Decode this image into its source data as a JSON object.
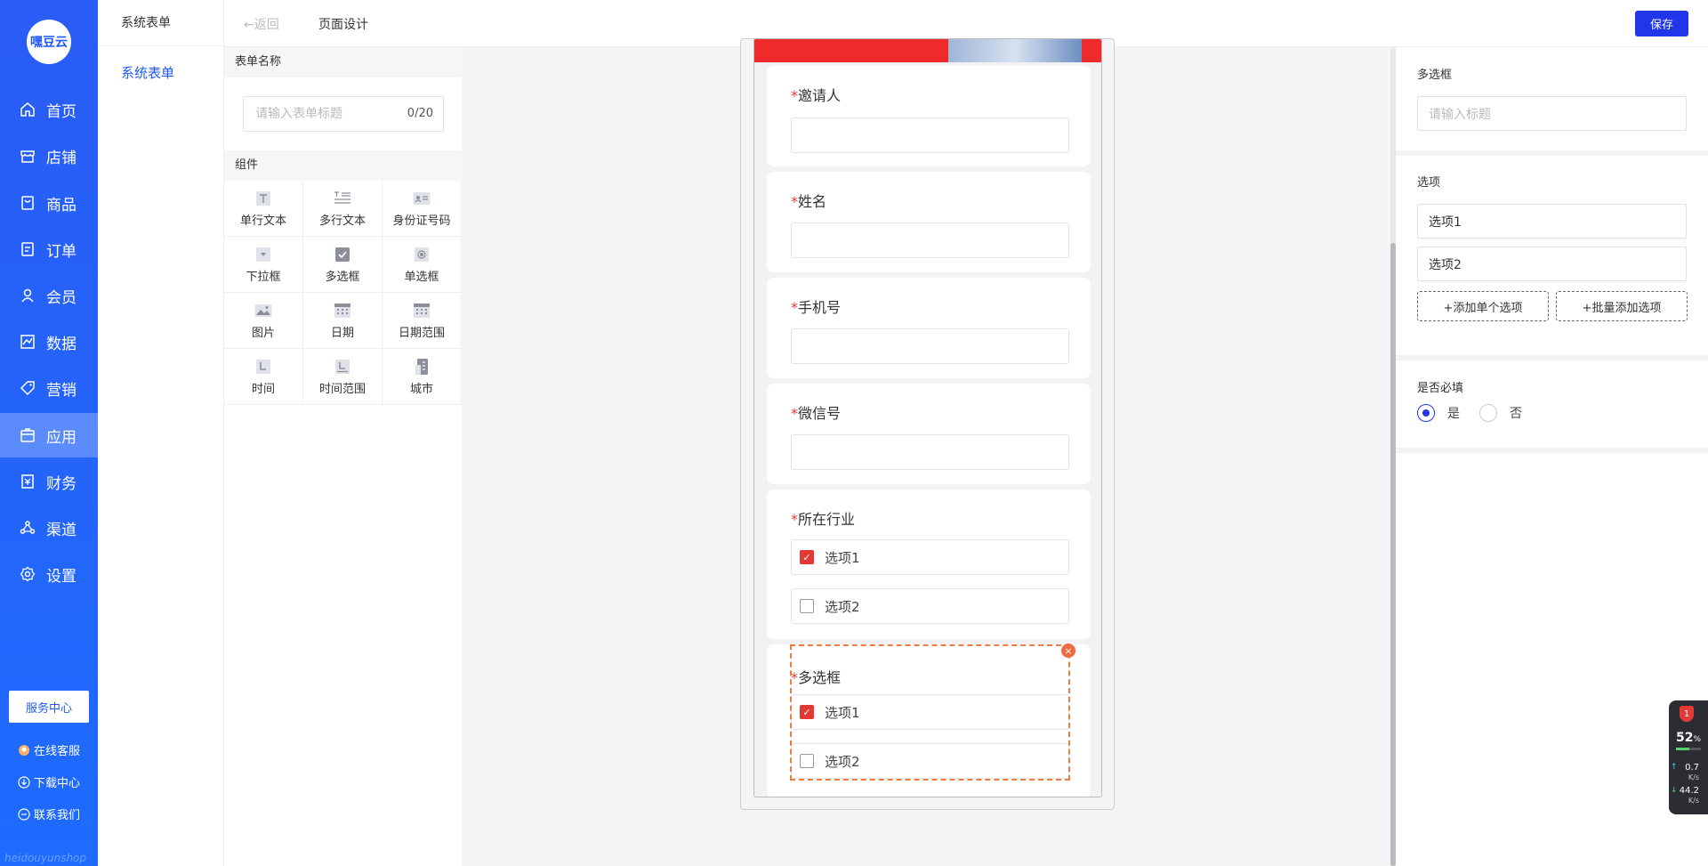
{
  "brand": {
    "logo_text": "嘿豆云",
    "footer_text": "heidouyunshop"
  },
  "nav": {
    "items": [
      {
        "label": "首页",
        "icon": "home-icon"
      },
      {
        "label": "店铺",
        "icon": "store-icon"
      },
      {
        "label": "商品",
        "icon": "goods-icon"
      },
      {
        "label": "订单",
        "icon": "order-icon"
      },
      {
        "label": "会员",
        "icon": "member-icon"
      },
      {
        "label": "数据",
        "icon": "chart-icon"
      },
      {
        "label": "营销",
        "icon": "tag-icon"
      },
      {
        "label": "应用",
        "icon": "app-icon",
        "active": true
      },
      {
        "label": "财务",
        "icon": "finance-icon"
      },
      {
        "label": "渠道",
        "icon": "channel-icon"
      },
      {
        "label": "设置",
        "icon": "gear-icon"
      }
    ],
    "service_center": "服务中心",
    "online_service": "在线客服",
    "download_center": "下载中心",
    "contact_us": "联系我们"
  },
  "subnav": {
    "title": "系统表单",
    "item": "系统表单"
  },
  "header": {
    "back": "返回",
    "title": "页面设计",
    "save": "保存"
  },
  "form_name": {
    "section": "表单名称",
    "placeholder": "请输入表单标题",
    "count": "0/20"
  },
  "components": {
    "section": "组件",
    "items": [
      {
        "label": "单行文本",
        "icon": "single-line-text-icon"
      },
      {
        "label": "多行文本",
        "icon": "multi-line-text-icon"
      },
      {
        "label": "身份证号码",
        "icon": "id-card-icon"
      },
      {
        "label": "下拉框",
        "icon": "dropdown-icon"
      },
      {
        "label": "多选框",
        "icon": "checkbox-icon"
      },
      {
        "label": "单选框",
        "icon": "radio-icon"
      },
      {
        "label": "图片",
        "icon": "image-icon"
      },
      {
        "label": "日期",
        "icon": "calendar-icon"
      },
      {
        "label": "日期范围",
        "icon": "date-range-icon"
      },
      {
        "label": "时间",
        "icon": "time-icon"
      },
      {
        "label": "时间范围",
        "icon": "time-range-icon"
      },
      {
        "label": "城市",
        "icon": "city-icon"
      }
    ]
  },
  "canvas": {
    "required_mark": "*",
    "fields": [
      {
        "label": "邀请人",
        "type": "input"
      },
      {
        "label": "姓名",
        "type": "input"
      },
      {
        "label": "手机号",
        "type": "input"
      },
      {
        "label": "微信号",
        "type": "input"
      },
      {
        "label": "所在行业",
        "type": "checkbox",
        "options": [
          {
            "label": "选项1",
            "checked": true
          },
          {
            "label": "选项2",
            "checked": false
          }
        ]
      },
      {
        "label": "多选框",
        "type": "checkbox",
        "selected": true,
        "options": [
          {
            "label": "选项1",
            "checked": true
          },
          {
            "label": "选项2",
            "checked": false
          }
        ]
      }
    ],
    "delete_glyph": "×"
  },
  "properties": {
    "title_label": "多选框",
    "title_placeholder": "请输入标题",
    "options_label": "选项",
    "options": [
      "选项1",
      "选项2"
    ],
    "add_single": "+添加单个选项",
    "add_batch": "+批量添加选项",
    "required_label": "是否必填",
    "required_yes": "是",
    "required_no": "否",
    "required_value": "是"
  },
  "net_widget": {
    "badge": "1",
    "percent": "52",
    "percent_unit": "%",
    "up": "0.7",
    "down": "44.2",
    "unit": "K/s"
  },
  "colors": {
    "primary": "#2136e8",
    "sidebar": "#2a5cf6",
    "required": "#e53935",
    "selected_border": "#f07b3f"
  }
}
